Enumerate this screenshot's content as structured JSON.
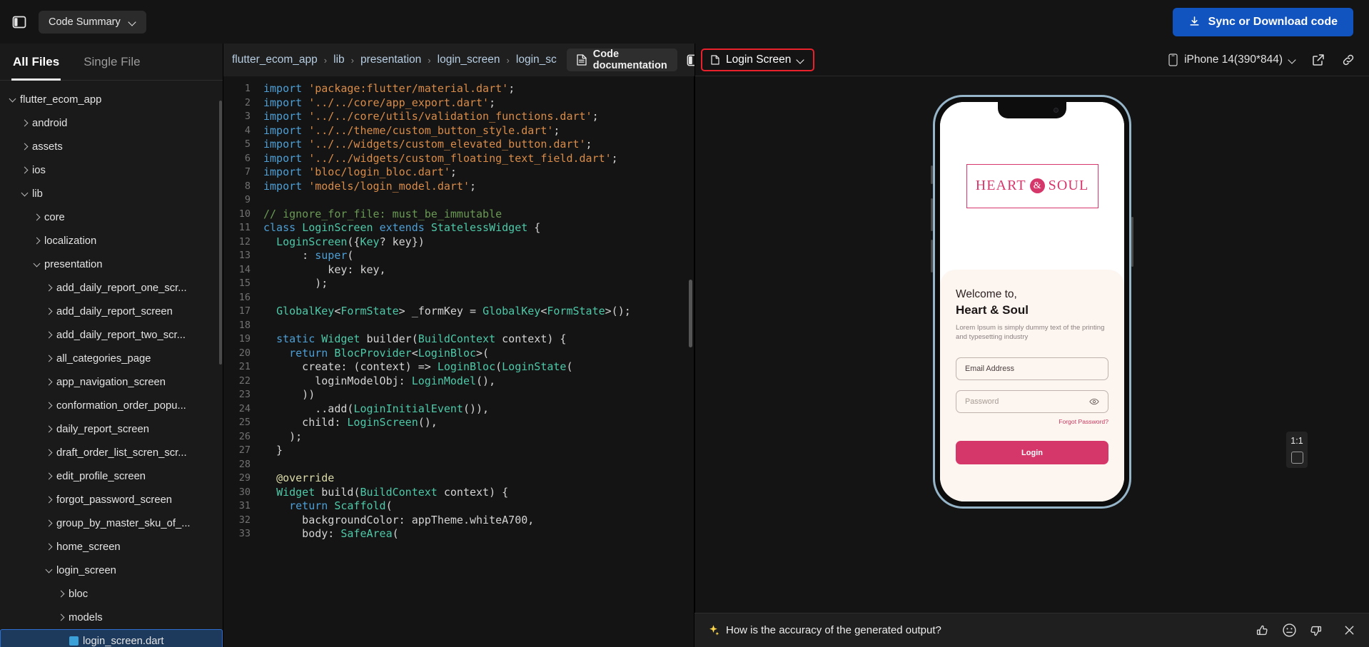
{
  "topbar": {
    "panel_toggle_icon": "panel-toggle-icon",
    "code_summary_label": "Code Summary",
    "sync_label": "Sync or Download code",
    "sync_icon": "download-icon",
    "accent_blue": "#1154bf"
  },
  "sidebar": {
    "tabs": [
      {
        "label": "All Files",
        "active": true
      },
      {
        "label": "Single File",
        "active": false
      }
    ],
    "tree": [
      {
        "label": "flutter_ecom_app",
        "depth": 0,
        "state": "open",
        "kind": "folder"
      },
      {
        "label": "android",
        "depth": 1,
        "state": "closed",
        "kind": "folder"
      },
      {
        "label": "assets",
        "depth": 1,
        "state": "closed",
        "kind": "folder"
      },
      {
        "label": "ios",
        "depth": 1,
        "state": "closed",
        "kind": "folder"
      },
      {
        "label": "lib",
        "depth": 1,
        "state": "open",
        "kind": "folder"
      },
      {
        "label": "core",
        "depth": 2,
        "state": "closed",
        "kind": "folder"
      },
      {
        "label": "localization",
        "depth": 2,
        "state": "closed",
        "kind": "folder"
      },
      {
        "label": "presentation",
        "depth": 2,
        "state": "open",
        "kind": "folder"
      },
      {
        "label": "add_daily_report_one_scr...",
        "depth": 3,
        "state": "closed",
        "kind": "folder"
      },
      {
        "label": "add_daily_report_screen",
        "depth": 3,
        "state": "closed",
        "kind": "folder"
      },
      {
        "label": "add_daily_report_two_scr...",
        "depth": 3,
        "state": "closed",
        "kind": "folder"
      },
      {
        "label": "all_categories_page",
        "depth": 3,
        "state": "closed",
        "kind": "folder"
      },
      {
        "label": "app_navigation_screen",
        "depth": 3,
        "state": "closed",
        "kind": "folder"
      },
      {
        "label": "conformation_order_popu...",
        "depth": 3,
        "state": "closed",
        "kind": "folder"
      },
      {
        "label": "daily_report_screen",
        "depth": 3,
        "state": "closed",
        "kind": "folder"
      },
      {
        "label": "draft_order_list_scren_scr...",
        "depth": 3,
        "state": "closed",
        "kind": "folder"
      },
      {
        "label": "edit_profile_screen",
        "depth": 3,
        "state": "closed",
        "kind": "folder"
      },
      {
        "label": "forgot_password_screen",
        "depth": 3,
        "state": "closed",
        "kind": "folder"
      },
      {
        "label": "group_by_master_sku_of_...",
        "depth": 3,
        "state": "closed",
        "kind": "folder"
      },
      {
        "label": "home_screen",
        "depth": 3,
        "state": "closed",
        "kind": "folder"
      },
      {
        "label": "login_screen",
        "depth": 3,
        "state": "open",
        "kind": "folder"
      },
      {
        "label": "bloc",
        "depth": 4,
        "state": "closed",
        "kind": "folder"
      },
      {
        "label": "models",
        "depth": 4,
        "state": "closed",
        "kind": "folder"
      },
      {
        "label": "login_screen.dart",
        "depth": 4,
        "state": "file",
        "kind": "dart",
        "selected": true
      }
    ]
  },
  "editor": {
    "breadcrumb": [
      "flutter_ecom_app",
      "lib",
      "presentation",
      "login_screen",
      "login_sc"
    ],
    "breadcrumb_separator": "›",
    "doc_button_label": "Code documentation",
    "doc_button_icon": "document-icon",
    "split_view_icon": "split-pane-icon",
    "lines": [
      {
        "n": 1,
        "tokens": [
          {
            "t": "import ",
            "c": "k"
          },
          {
            "t": "'package:flutter/material.dart'",
            "c": "s"
          },
          {
            "t": ";",
            "c": "p"
          }
        ]
      },
      {
        "n": 2,
        "tokens": [
          {
            "t": "import ",
            "c": "k"
          },
          {
            "t": "'../../core/app_export.dart'",
            "c": "s"
          },
          {
            "t": ";",
            "c": "p"
          }
        ]
      },
      {
        "n": 3,
        "tokens": [
          {
            "t": "import ",
            "c": "k"
          },
          {
            "t": "'../../core/utils/validation_functions.dart'",
            "c": "s"
          },
          {
            "t": ";",
            "c": "p"
          }
        ]
      },
      {
        "n": 4,
        "tokens": [
          {
            "t": "import ",
            "c": "k"
          },
          {
            "t": "'../../theme/custom_button_style.dart'",
            "c": "s"
          },
          {
            "t": ";",
            "c": "p"
          }
        ]
      },
      {
        "n": 5,
        "tokens": [
          {
            "t": "import ",
            "c": "k"
          },
          {
            "t": "'../../widgets/custom_elevated_button.dart'",
            "c": "s"
          },
          {
            "t": ";",
            "c": "p"
          }
        ]
      },
      {
        "n": 6,
        "tokens": [
          {
            "t": "import ",
            "c": "k"
          },
          {
            "t": "'../../widgets/custom_floating_text_field.dart'",
            "c": "s"
          },
          {
            "t": ";",
            "c": "p"
          }
        ]
      },
      {
        "n": 7,
        "tokens": [
          {
            "t": "import ",
            "c": "k"
          },
          {
            "t": "'bloc/login_bloc.dart'",
            "c": "s"
          },
          {
            "t": ";",
            "c": "p"
          }
        ]
      },
      {
        "n": 8,
        "tokens": [
          {
            "t": "import ",
            "c": "k"
          },
          {
            "t": "'models/login_model.dart'",
            "c": "s"
          },
          {
            "t": ";",
            "c": "p"
          }
        ]
      },
      {
        "n": 9,
        "tokens": []
      },
      {
        "n": 10,
        "tokens": [
          {
            "t": "// ignore_for_file: must_be_immutable",
            "c": "cm"
          }
        ]
      },
      {
        "n": 11,
        "tokens": [
          {
            "t": "class ",
            "c": "k"
          },
          {
            "t": "LoginScreen ",
            "c": "t"
          },
          {
            "t": "extends ",
            "c": "k"
          },
          {
            "t": "StatelessWidget",
            "c": "t"
          },
          {
            "t": " {",
            "c": "p"
          }
        ]
      },
      {
        "n": 12,
        "tokens": [
          {
            "t": "  ",
            "c": "p"
          },
          {
            "t": "LoginScreen",
            "c": "t"
          },
          {
            "t": "({",
            "c": "p"
          },
          {
            "t": "Key",
            "c": "t"
          },
          {
            "t": "? key})",
            "c": "p"
          }
        ]
      },
      {
        "n": 13,
        "tokens": [
          {
            "t": "      : ",
            "c": "p"
          },
          {
            "t": "super",
            "c": "k"
          },
          {
            "t": "(",
            "c": "p"
          }
        ]
      },
      {
        "n": 14,
        "tokens": [
          {
            "t": "          key: key,",
            "c": "p"
          }
        ]
      },
      {
        "n": 15,
        "tokens": [
          {
            "t": "        );",
            "c": "p"
          }
        ]
      },
      {
        "n": 16,
        "tokens": []
      },
      {
        "n": 17,
        "tokens": [
          {
            "t": "  ",
            "c": "p"
          },
          {
            "t": "GlobalKey",
            "c": "t"
          },
          {
            "t": "<",
            "c": "p"
          },
          {
            "t": "FormState",
            "c": "t"
          },
          {
            "t": "> _formKey = ",
            "c": "p"
          },
          {
            "t": "GlobalKey",
            "c": "t"
          },
          {
            "t": "<",
            "c": "p"
          },
          {
            "t": "FormState",
            "c": "t"
          },
          {
            "t": ">();",
            "c": "p"
          }
        ]
      },
      {
        "n": 18,
        "tokens": []
      },
      {
        "n": 19,
        "tokens": [
          {
            "t": "  ",
            "c": "p"
          },
          {
            "t": "static ",
            "c": "k"
          },
          {
            "t": "Widget ",
            "c": "t"
          },
          {
            "t": "builder",
            "c": "p"
          },
          {
            "t": "(",
            "c": "p"
          },
          {
            "t": "BuildContext",
            "c": "t"
          },
          {
            "t": " context) {",
            "c": "p"
          }
        ]
      },
      {
        "n": 20,
        "tokens": [
          {
            "t": "    ",
            "c": "p"
          },
          {
            "t": "return ",
            "c": "k"
          },
          {
            "t": "BlocProvider",
            "c": "t"
          },
          {
            "t": "<",
            "c": "p"
          },
          {
            "t": "LoginBloc",
            "c": "t"
          },
          {
            "t": ">(",
            "c": "p"
          }
        ]
      },
      {
        "n": 21,
        "tokens": [
          {
            "t": "      create: (context) => ",
            "c": "p"
          },
          {
            "t": "LoginBloc",
            "c": "t"
          },
          {
            "t": "(",
            "c": "p"
          },
          {
            "t": "LoginState",
            "c": "t"
          },
          {
            "t": "(",
            "c": "p"
          }
        ]
      },
      {
        "n": 22,
        "tokens": [
          {
            "t": "        loginModelObj: ",
            "c": "p"
          },
          {
            "t": "LoginModel",
            "c": "t"
          },
          {
            "t": "(),",
            "c": "p"
          }
        ]
      },
      {
        "n": 23,
        "tokens": [
          {
            "t": "      ))",
            "c": "p"
          }
        ]
      },
      {
        "n": 24,
        "tokens": [
          {
            "t": "        ..add(",
            "c": "p"
          },
          {
            "t": "LoginInitialEvent",
            "c": "t"
          },
          {
            "t": "()),",
            "c": "p"
          }
        ]
      },
      {
        "n": 25,
        "tokens": [
          {
            "t": "      child: ",
            "c": "p"
          },
          {
            "t": "LoginScreen",
            "c": "t"
          },
          {
            "t": "(),",
            "c": "p"
          }
        ]
      },
      {
        "n": 26,
        "tokens": [
          {
            "t": "    );",
            "c": "p"
          }
        ]
      },
      {
        "n": 27,
        "tokens": [
          {
            "t": "  }",
            "c": "p"
          }
        ]
      },
      {
        "n": 28,
        "tokens": []
      },
      {
        "n": 29,
        "tokens": [
          {
            "t": "  ",
            "c": "p"
          },
          {
            "t": "@override",
            "c": "f"
          }
        ]
      },
      {
        "n": 30,
        "tokens": [
          {
            "t": "  ",
            "c": "p"
          },
          {
            "t": "Widget ",
            "c": "t"
          },
          {
            "t": "build",
            "c": "p"
          },
          {
            "t": "(",
            "c": "p"
          },
          {
            "t": "BuildContext",
            "c": "t"
          },
          {
            "t": " context) {",
            "c": "p"
          }
        ]
      },
      {
        "n": 31,
        "tokens": [
          {
            "t": "    ",
            "c": "p"
          },
          {
            "t": "return ",
            "c": "k"
          },
          {
            "t": "Scaffold",
            "c": "t"
          },
          {
            "t": "(",
            "c": "p"
          }
        ]
      },
      {
        "n": 32,
        "tokens": [
          {
            "t": "      backgroundColor: appTheme.whiteA700,",
            "c": "p"
          }
        ]
      },
      {
        "n": 33,
        "tokens": [
          {
            "t": "      body: ",
            "c": "p"
          },
          {
            "t": "SafeArea",
            "c": "t"
          },
          {
            "t": "(",
            "c": "p"
          }
        ]
      }
    ]
  },
  "preview": {
    "screen_name": "Login Screen",
    "screen_icon": "document-icon",
    "highlight_color": "#e8212d",
    "device_name": "iPhone 14(390*844)",
    "device_icon": "mobile-icon",
    "open_external_icon": "external-link-icon",
    "copy_link_icon": "link-icon",
    "zoom_level": "1:1",
    "fit_icon": "fit-to-screen-icon",
    "mock": {
      "logo_left": "HEART",
      "logo_amp": "&",
      "logo_right": "SOUL",
      "welcome_line1": "Welcome to,",
      "welcome_line2": "Heart & Soul",
      "welcome_sub": "Lorem Ipsum is simply dummy text of the printing and typesetting industry",
      "email_placeholder": "Email Address",
      "password_placeholder": "Password",
      "eye_icon": "eye-icon",
      "forgot_label": "Forgot Password?",
      "login_label": "Login",
      "brand_color": "#d6376b"
    }
  },
  "feedback": {
    "sparkle_icon": "sparkle-icon",
    "question": "How is the accuracy of the generated output?",
    "thumbs_up_icon": "thumbs-up-icon",
    "neutral_icon": "neutral-face-icon",
    "thumbs_down_icon": "thumbs-down-icon",
    "close_icon": "close-icon"
  }
}
